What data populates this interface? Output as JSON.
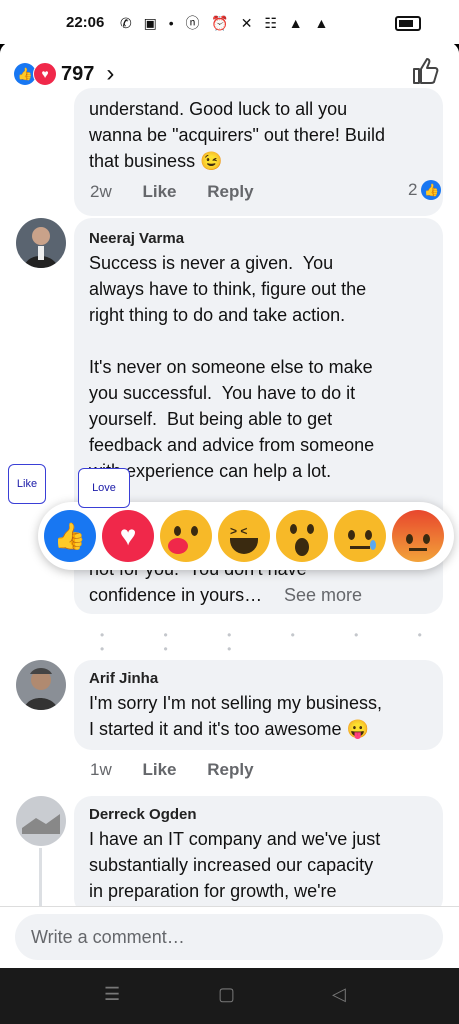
{
  "status_bar": {
    "time": "22:06"
  },
  "header": {
    "reaction_count": "797",
    "chevron": "›"
  },
  "comments": [
    {
      "text": "understand. Good luck to all you\nwanna be \"acquirers\" out there! Build\nthat business 😉",
      "time": "2w",
      "like": "Like",
      "reply": "Reply",
      "reactions": "2"
    },
    {
      "name": "Neeraj Varma",
      "text": "Success is never a given.  You\nalways have to think, figure out the\nright thing to do and take action.\n\nIt's never on someone else to make\nyou successful.  You have to do it\nyourself.  But being able to get\nfeedback and advice from someone\nwith experience can help a lot.",
      "text_tail": "not for you.  You don't have\nconfidence in yours…",
      "see_more": "See more"
    },
    {
      "name": "Arif Jinha",
      "text": "I'm sorry I'm not selling my business,\nI started it and it's too awesome 😛",
      "time": "1w",
      "like": "Like",
      "reply": "Reply"
    },
    {
      "name": "Derreck Ogden",
      "text": "I have an IT company and we've just\nsubstantially increased our capacity\nin preparation for growth, we're"
    }
  ],
  "reaction_picker": {
    "tooltip_like": "Like",
    "tooltip_love": "Love",
    "items": [
      "like-icon",
      "love-icon",
      "care-icon",
      "haha-icon",
      "wow-icon",
      "sad-icon",
      "angry-icon"
    ]
  },
  "composer": {
    "placeholder": "Write a comment…"
  }
}
